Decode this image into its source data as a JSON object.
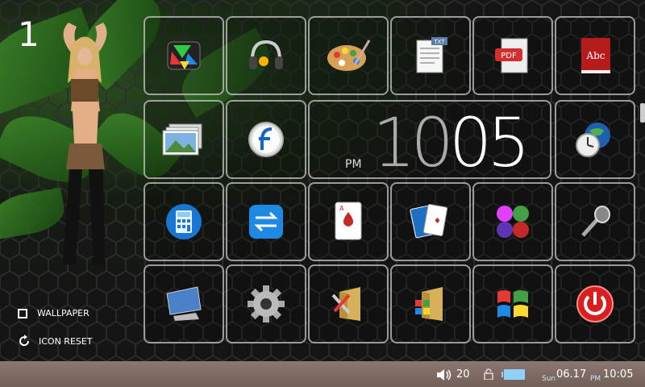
{
  "home": {
    "page_number": "1"
  },
  "clock": {
    "ampm": "PM",
    "hour": "10",
    "minute": "05"
  },
  "options": {
    "wallpaper": "WALLPAPER",
    "icon_reset": "ICON RESET"
  },
  "apps": [
    {
      "icon": "media-player-icon"
    },
    {
      "icon": "music-headphones-icon"
    },
    {
      "icon": "paint-palette-icon"
    },
    {
      "icon": "text-document-icon",
      "badge": "TXT"
    },
    {
      "icon": "pdf-document-icon",
      "badge": "PDF"
    },
    {
      "icon": "dictionary-book-icon",
      "badge": "Abc"
    },
    {
      "icon": "photo-gallery-icon"
    },
    {
      "icon": "flash-player-icon"
    },
    {
      "icon": "world-clock-icon"
    },
    {
      "icon": "calculator-icon"
    },
    {
      "icon": "converter-icon"
    },
    {
      "icon": "card-game-icon"
    },
    {
      "icon": "solitaire-cards-icon"
    },
    {
      "icon": "color-balls-game-icon"
    },
    {
      "icon": "microphone-icon"
    },
    {
      "icon": "desktop-display-icon"
    },
    {
      "icon": "settings-gear-icon"
    },
    {
      "icon": "tools-folder-icon"
    },
    {
      "icon": "windows-folder-icon"
    },
    {
      "icon": "windows-logo-icon"
    },
    {
      "icon": "power-icon"
    }
  ],
  "statusbar": {
    "volume": "20",
    "day": "Sun",
    "date": "06.17",
    "ampm": "PM",
    "time": "10:05"
  },
  "colors": {
    "status_bar": "#7f6b64",
    "tile_border": "#c8c8c8",
    "power_red": "#d81e1e"
  }
}
